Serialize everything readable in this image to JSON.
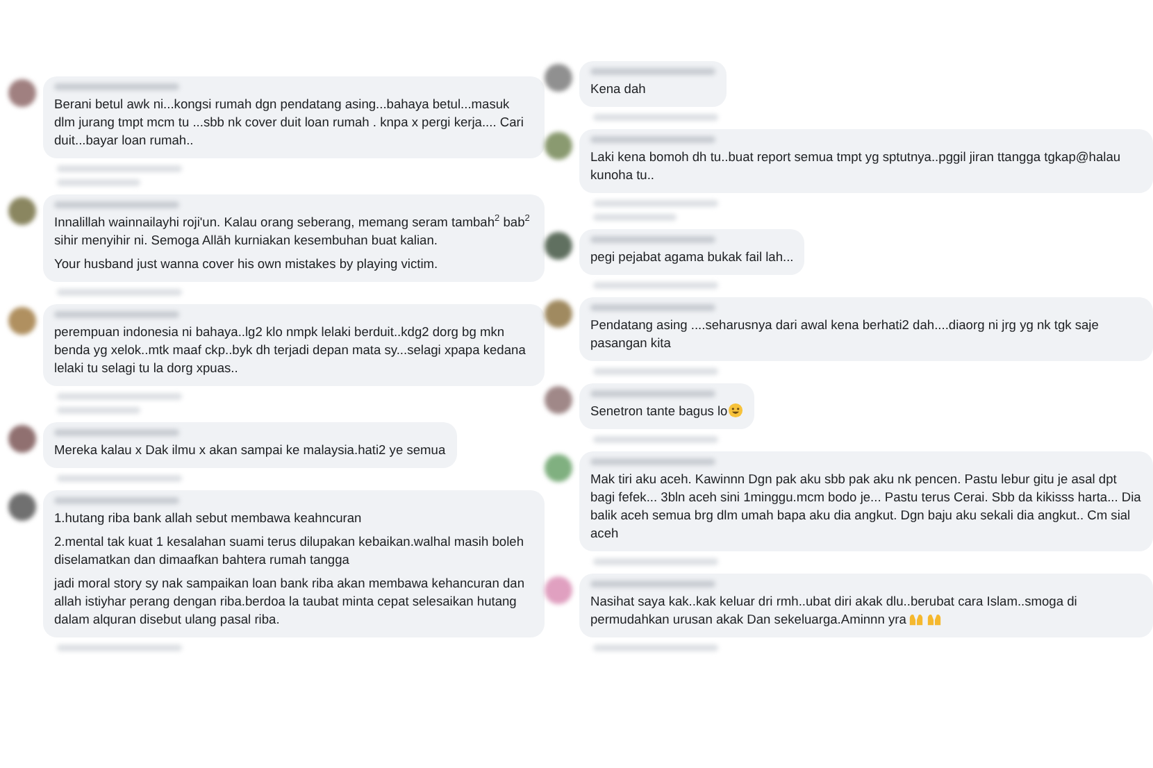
{
  "columns": [
    {
      "comments": [
        {
          "color": "#a08080",
          "paragraphs": [
            "Berani betul awk ni...kongsi rumah dgn pendatang asing...bahaya betul...masuk dlm jurang tmpt mcm tu ...sbb nk cover duit loan rumah . knpa x pergi kerja.... Cari duit...bayar loan rumah.."
          ],
          "replies_line": true
        },
        {
          "color": "#8a8660",
          "paragraphs": [
            "Innalillah wainnailayhi roji'un. Kalau orang seberang, memang seram tambah$^{2}$ bab$^{2}$ sihir menyihir ni. Semoga Allāh kurniakan kesembuhan buat kalian.",
            "Your husband just wanna cover his own mistakes by playing victim."
          ],
          "replies_line": false
        },
        {
          "color": "#b09060",
          "paragraphs": [
            "perempuan indonesia ni bahaya..lg2 klo nmpk lelaki berduit..kdg2 dorg bg mkn benda yg xelok..mtk maaf ckp..byk dh terjadi depan mata sy...selagi xpapa kedana lelaki tu selagi tu la dorg xpuas.."
          ],
          "replies_line": true
        },
        {
          "color": "#907070",
          "paragraphs": [
            "Mereka kalau x Dak ilmu x akan sampai ke malaysia.hati2 ye semua"
          ],
          "replies_line": false
        },
        {
          "color": "#707070",
          "paragraphs": [
            "1.hutang riba bank allah sebut membawa keahncuran",
            "2.mental tak kuat 1 kesalahan suami terus dilupakan kebaikan.walhal masih boleh diselamatkan dan dimaafkan bahtera rumah tangga",
            "jadi moral story sy nak sampaikan loan bank riba akan membawa kehancuran dan allah istiyhar perang dengan riba.berdoa la taubat minta cepat selesaikan hutang dalam alquran disebut ulang pasal riba."
          ],
          "replies_line": false
        }
      ]
    },
    {
      "comments": [
        {
          "color": "#909090",
          "paragraphs": [
            "Kena dah"
          ],
          "replies_line": false
        },
        {
          "color": "#8a9a70",
          "paragraphs": [
            "Laki kena bomoh dh tu..buat report semua tmpt yg sptutnya..pggil jiran ttangga tgkap@halau kunoha tu.."
          ],
          "replies_line": true
        },
        {
          "color": "#607060",
          "paragraphs": [
            "pegi pejabat agama bukak fail lah..."
          ],
          "replies_line": false
        },
        {
          "color": "#a08a60",
          "paragraphs": [
            "Pendatang asing ....seharusnya dari awal kena berhati2 dah....diaorg ni jrg yg nk tgk saje pasangan kita"
          ],
          "replies_line": false
        },
        {
          "color": "#a08888",
          "paragraphs": [
            "Senetron tante bagus lo"
          ],
          "replies_line": false,
          "icons": [
            {
              "kind": "smiley"
            }
          ]
        },
        {
          "color": "#80b080",
          "paragraphs": [
            "Mak tiri aku aceh. Kawinnn Dgn pak aku sbb pak aku nk pencen. Pastu lebur gitu je asal dpt bagi fefek... 3bln aceh sini 1minggu.mcm bodo je... Pastu terus Cerai. Sbb da kikisss harta... Dia balik aceh semua brg dlm umah bapa aku dia angkut. Dgn baju aku sekali dia angkut.. Cm sial aceh"
          ],
          "replies_line": false
        },
        {
          "color": "#e0a0c0",
          "paragraphs": [
            "Nasihat saya kak..kak keluar dri rmh..ubat diri akak dlu..berubat cara Islam..smoga di permudahkan urusan akak Dan sekeluarga.Aminnn yra"
          ],
          "replies_line": false,
          "icons": [
            {
              "kind": "hands"
            },
            {
              "kind": "hands"
            }
          ]
        }
      ]
    }
  ]
}
